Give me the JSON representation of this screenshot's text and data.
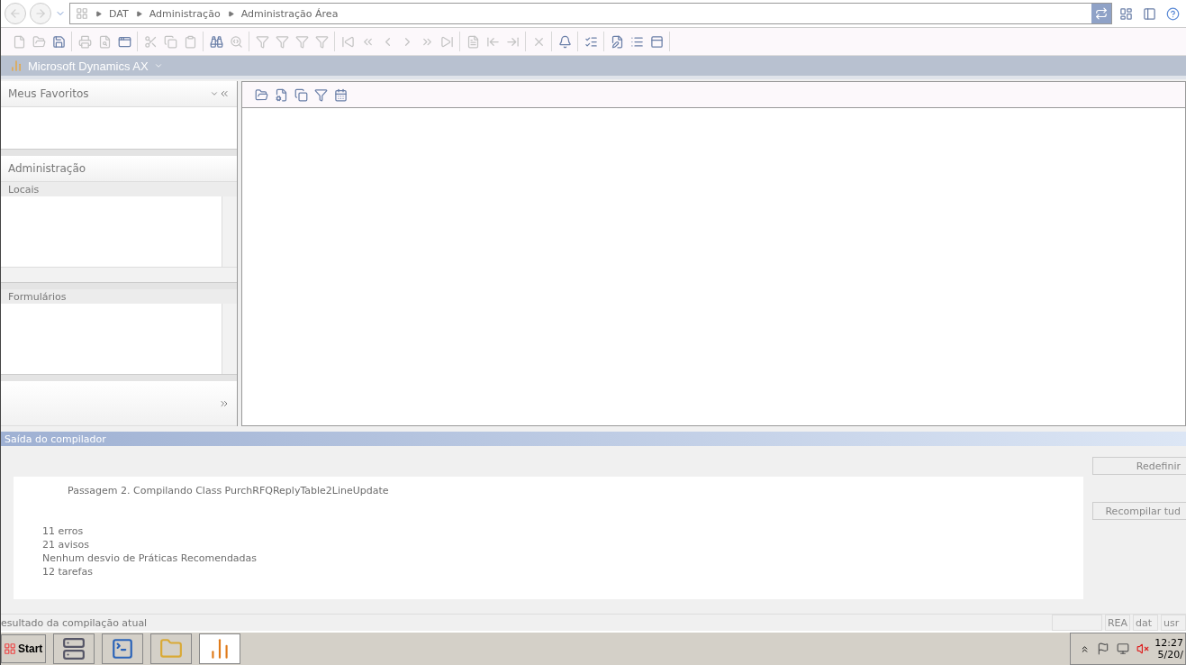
{
  "address_bar": {
    "breadcrumbs": [
      "DAT",
      "Administração",
      "Administração Área"
    ]
  },
  "toolbar": {
    "groups": [
      [
        {
          "kind": "new",
          "disabled": true
        },
        {
          "kind": "open",
          "disabled": true
        },
        {
          "kind": "save",
          "disabled": false
        }
      ],
      [
        {
          "kind": "print",
          "disabled": true
        },
        {
          "kind": "preview",
          "disabled": true
        },
        {
          "kind": "form",
          "disabled": false
        }
      ],
      [
        {
          "kind": "cut",
          "disabled": true
        },
        {
          "kind": "copy",
          "disabled": true
        },
        {
          "kind": "paste",
          "disabled": true
        }
      ],
      [
        {
          "kind": "find",
          "disabled": false
        },
        {
          "kind": "findnext",
          "disabled": true
        }
      ],
      [
        {
          "kind": "filter",
          "disabled": true
        },
        {
          "kind": "filter",
          "disabled": true
        },
        {
          "kind": "filter",
          "disabled": true
        },
        {
          "kind": "filter",
          "disabled": true
        }
      ],
      [
        {
          "kind": "first",
          "disabled": true
        },
        {
          "kind": "prevpage",
          "disabled": true
        },
        {
          "kind": "prev",
          "disabled": true
        },
        {
          "kind": "next",
          "disabled": true
        },
        {
          "kind": "nextpage",
          "disabled": true
        },
        {
          "kind": "last",
          "disabled": true
        }
      ],
      [
        {
          "kind": "attach",
          "disabled": true
        },
        {
          "kind": "import",
          "disabled": true
        },
        {
          "kind": "export",
          "disabled": true
        }
      ],
      [
        {
          "kind": "delete",
          "disabled": true
        }
      ],
      [
        {
          "kind": "alert",
          "disabled": false
        }
      ],
      [
        {
          "kind": "checklist",
          "disabled": false
        }
      ],
      [
        {
          "kind": "edit",
          "disabled": false
        },
        {
          "kind": "list",
          "disabled": false
        },
        {
          "kind": "window",
          "disabled": false
        }
      ]
    ]
  },
  "app_bar": {
    "title": "Microsoft Dynamics AX"
  },
  "navigation": {
    "favorites_title": "Meus Favoritos",
    "module_title": "Administração",
    "panes": [
      {
        "title": "Locais"
      },
      {
        "title": "Formulários"
      }
    ]
  },
  "content_toolbar": [
    {
      "kind": "open"
    },
    {
      "kind": "properties"
    },
    {
      "kind": "copy"
    },
    {
      "kind": "filter"
    },
    {
      "kind": "calendar"
    }
  ],
  "compiler": {
    "title": "Saída do compilador",
    "lines": [
      {
        "kind": "pass",
        "text": "Passagem 2. Compilando Class PurchRFQReplyTable2LineUpdate"
      },
      {
        "kind": "summary",
        "text": "11 erros"
      },
      {
        "kind": "summary",
        "text": "21 avisos"
      },
      {
        "kind": "summary",
        "text": "Nenhum desvio de Práticas Recomendadas"
      },
      {
        "kind": "summary",
        "text": "12 tarefas"
      }
    ],
    "buttons": [
      "Redefinir",
      "Recompilar tud"
    ]
  },
  "status_bar": {
    "message": "esultado da compilação atual",
    "fields": [
      "REA",
      "dat",
      "usr"
    ]
  },
  "taskbar": {
    "start": "Start",
    "apps": [
      {
        "kind": "server",
        "selected": false
      },
      {
        "kind": "powershell",
        "selected": false
      },
      {
        "kind": "explorer",
        "selected": false
      },
      {
        "kind": "dynamics",
        "selected": true
      }
    ],
    "time": "12:27",
    "date": "5/20/"
  }
}
